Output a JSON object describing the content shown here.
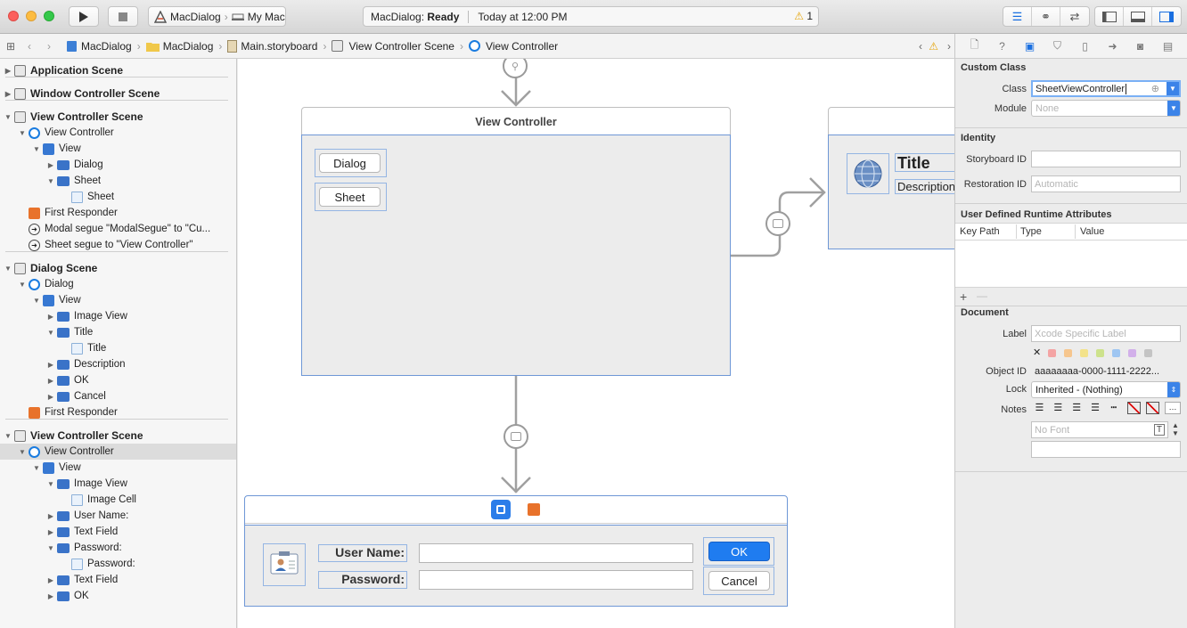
{
  "toolbar": {
    "scheme_app": "MacDialog",
    "scheme_device": "My Mac",
    "activity_app": "MacDialog:",
    "activity_status": "Ready",
    "activity_time": "Today at 12:00 PM",
    "warning_count": "1"
  },
  "jumpbar": {
    "items": [
      "MacDialog",
      "MacDialog",
      "Main.storyboard",
      "View Controller Scene",
      "View Controller"
    ]
  },
  "outline": {
    "rows": [
      {
        "label": "Application Scene",
        "indent": 0,
        "disc": "▶",
        "icon": "scene",
        "scene": true
      },
      {
        "label": "Window Controller Scene",
        "indent": 0,
        "disc": "▶",
        "icon": "scene",
        "scene": true
      },
      {
        "label": "View Controller Scene",
        "indent": 0,
        "disc": "▼",
        "icon": "scene",
        "scene": true
      },
      {
        "label": "View Controller",
        "indent": 1,
        "disc": "▼",
        "icon": "vc"
      },
      {
        "label": "View",
        "indent": 2,
        "disc": "▼",
        "icon": "view"
      },
      {
        "label": "Dialog",
        "indent": 3,
        "disc": "▶",
        "icon": "btn"
      },
      {
        "label": "Sheet",
        "indent": 3,
        "disc": "▼",
        "icon": "btn"
      },
      {
        "label": "Sheet",
        "indent": 4,
        "disc": "",
        "icon": "cell"
      },
      {
        "label": "First Responder",
        "indent": 1,
        "disc": "",
        "icon": "fr"
      },
      {
        "label": "Modal segue \"ModalSegue\" to \"Cu...",
        "indent": 1,
        "disc": "",
        "icon": "segue"
      },
      {
        "label": "Sheet segue to \"View Controller\"",
        "indent": 1,
        "disc": "",
        "icon": "segue"
      },
      {
        "label": "Dialog Scene",
        "indent": 0,
        "disc": "▼",
        "icon": "scene",
        "scene": true
      },
      {
        "label": "Dialog",
        "indent": 1,
        "disc": "▼",
        "icon": "vc"
      },
      {
        "label": "View",
        "indent": 2,
        "disc": "▼",
        "icon": "view"
      },
      {
        "label": "Image View",
        "indent": 3,
        "disc": "▶",
        "icon": "btn"
      },
      {
        "label": "Title",
        "indent": 3,
        "disc": "▼",
        "icon": "btn"
      },
      {
        "label": "Title",
        "indent": 4,
        "disc": "",
        "icon": "cell"
      },
      {
        "label": "Description",
        "indent": 3,
        "disc": "▶",
        "icon": "btn"
      },
      {
        "label": "OK",
        "indent": 3,
        "disc": "▶",
        "icon": "btn"
      },
      {
        "label": "Cancel",
        "indent": 3,
        "disc": "▶",
        "icon": "btn"
      },
      {
        "label": "First Responder",
        "indent": 1,
        "disc": "",
        "icon": "fr"
      },
      {
        "label": "View Controller Scene",
        "indent": 0,
        "disc": "▼",
        "icon": "scene",
        "scene": true
      },
      {
        "label": "View Controller",
        "indent": 1,
        "disc": "▼",
        "icon": "vc",
        "selected": true
      },
      {
        "label": "View",
        "indent": 2,
        "disc": "▼",
        "icon": "view"
      },
      {
        "label": "Image View",
        "indent": 3,
        "disc": "▼",
        "icon": "btn"
      },
      {
        "label": "Image Cell",
        "indent": 4,
        "disc": "",
        "icon": "cell"
      },
      {
        "label": "User Name:",
        "indent": 3,
        "disc": "▶",
        "icon": "btn"
      },
      {
        "label": "Text Field",
        "indent": 3,
        "disc": "▶",
        "icon": "btn"
      },
      {
        "label": "Password:",
        "indent": 3,
        "disc": "▼",
        "icon": "btn"
      },
      {
        "label": "Password:",
        "indent": 4,
        "disc": "",
        "icon": "cell"
      },
      {
        "label": "Text Field",
        "indent": 3,
        "disc": "▶",
        "icon": "btn"
      },
      {
        "label": "OK",
        "indent": 3,
        "disc": "▶",
        "icon": "btn"
      }
    ]
  },
  "canvas": {
    "vc_title": "View Controller",
    "dialog_button": "Dialog",
    "sheet_button": "Sheet",
    "dialog_title": "Title",
    "dialog_description": "Description",
    "username_label": "User Name:",
    "password_label": "Password:",
    "ok_button": "OK",
    "cancel_button": "Cancel",
    "default_button_color": "#1f7cf0"
  },
  "inspector": {
    "custom_class": {
      "header": "Custom Class",
      "class_label": "Class",
      "class_value": "SheetViewController",
      "module_label": "Module",
      "module_placeholder": "None"
    },
    "identity": {
      "header": "Identity",
      "storyboard_label": "Storyboard ID",
      "restoration_label": "Restoration ID",
      "restoration_placeholder": "Automatic"
    },
    "runtime": {
      "header": "User Defined Runtime Attributes",
      "columns": [
        "Key Path",
        "Type",
        "Value"
      ],
      "add": "+",
      "remove": "—"
    },
    "document": {
      "header": "Document",
      "label_label": "Label",
      "label_placeholder": "Xcode Specific Label",
      "clear": "✕",
      "object_id_label": "Object ID",
      "object_id": "aaaaaaaa-0000-1111-2222...",
      "lock_label": "Lock",
      "lock_value": "Inherited - (Nothing)",
      "notes_label": "Notes",
      "font_placeholder": "No Font",
      "swatch_colors": [
        "#f4a4a4",
        "#f6c68e",
        "#f3e28a",
        "#cde28c",
        "#9fc6f2",
        "#d2b0ea",
        "#c4c4c4"
      ]
    }
  }
}
